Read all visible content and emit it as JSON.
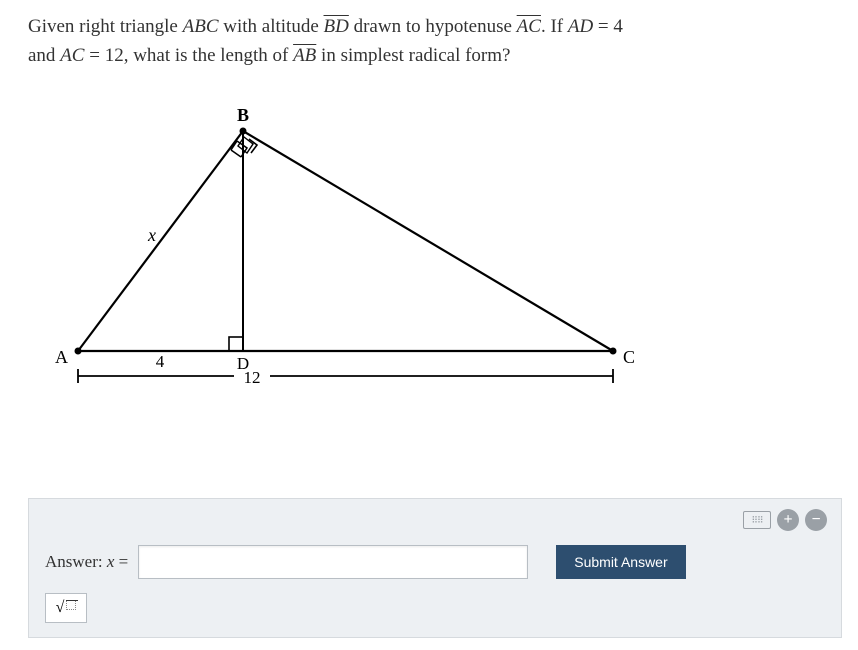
{
  "problem": {
    "line1_pre": "Given right triangle ",
    "tri": "ABC",
    "with_alt": " with altitude ",
    "alt_seg": "BD",
    "drawn_to": " drawn to hypotenuse ",
    "hyp_seg": "AC",
    "period_if": ". If ",
    "ad_var": "AD",
    "eq1": " = ",
    "ad_val": "4",
    "line2_and": "and ",
    "ac_var": "AC",
    "eq2": " = ",
    "ac_val": "12",
    "what_is": ", what is the length of ",
    "ab_seg": "AB",
    "tail": " in simplest radical form?"
  },
  "diagram": {
    "labels": {
      "A": "A",
      "B": "B",
      "C": "C",
      "D": "D",
      "x": "x",
      "ad": "4",
      "ac": "12"
    }
  },
  "answer": {
    "label_pre": "Answer: ",
    "var": "x",
    "eq": " =",
    "value": "",
    "placeholder": ""
  },
  "buttons": {
    "submit": "Submit Answer",
    "plus": "+",
    "minus": "−"
  },
  "chart_data": {
    "type": "diagram",
    "description": "Right triangle ABC with right angle at B, altitude BD to hypotenuse AC",
    "given": {
      "AD": 4,
      "AC": 12
    },
    "unknown": "AB (labeled x)"
  }
}
